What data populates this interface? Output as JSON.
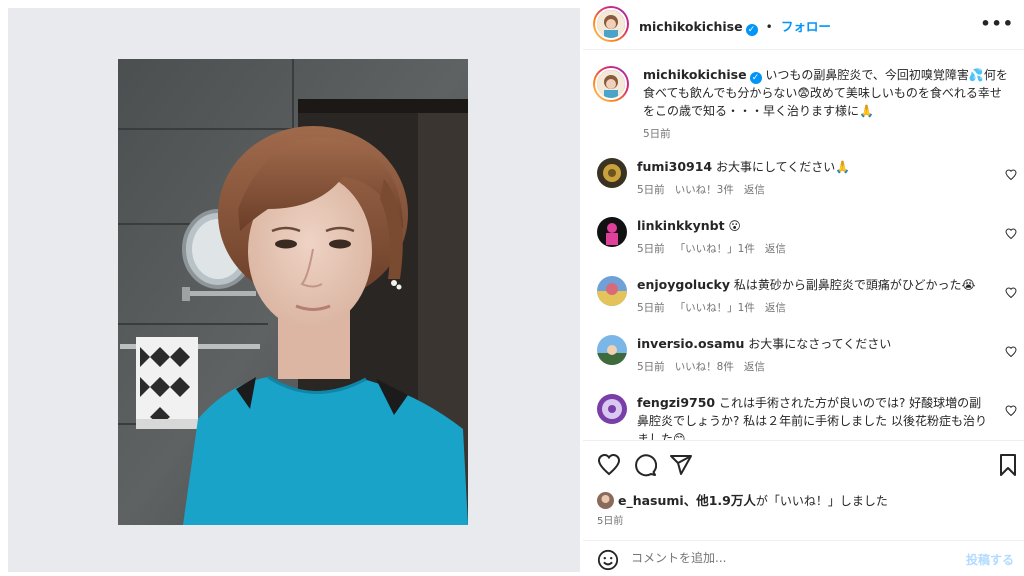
{
  "post": {
    "username": "michikokichise",
    "verified_mark": "✓",
    "separator": "•",
    "follow_label": "フォロー",
    "more_label": "•••",
    "caption": "いつもの副鼻腔炎で、今回初嗅覚障害💦何を食べても飲んでも分からない😨改めて美味しいものを食べれる幸せをこの歳で知る・・・早く治ります様に🙏",
    "caption_time": "5日前"
  },
  "comments": [
    {
      "username": "fumi30914",
      "text": "お大事にしてください🙏",
      "time": "5日前",
      "likes": "いいね！3件",
      "reply": "返信"
    },
    {
      "username": "linkinkkynbt",
      "text": "😮",
      "time": "5日前",
      "likes": "「いいね！」1件",
      "reply": "返信"
    },
    {
      "username": "enjoygolucky",
      "text": "私は黄砂から副鼻腔炎で頭痛がひどかった😭",
      "time": "5日前",
      "likes": "「いいね！」1件",
      "reply": "返信"
    },
    {
      "username": "inversio.osamu",
      "text": "お大事になさってください",
      "time": "5日前",
      "likes": "いいね！8件",
      "reply": "返信"
    },
    {
      "username": "fengzi9750",
      "text": "これは手術された方が良いのでは? 好酸球増の副鼻腔炎でしょうか? 私は２年前に手術しました 以後花粉症も治りました😊",
      "time": "",
      "likes": "",
      "reply": ""
    }
  ],
  "footer": {
    "likes_user": "e_hasumi",
    "likes_rest": "、他1.9万人",
    "likes_suffix": "が「いいね！」しました",
    "date": "5日前",
    "comment_placeholder": "コメントを追加...",
    "post_label": "投稿する"
  },
  "icons": {
    "like": "heart-icon",
    "comment": "comment-icon",
    "share": "paper-plane-icon",
    "save": "bookmark-icon",
    "emoji": "smiley-icon"
  },
  "colors": {
    "accent": "#0095f6",
    "post_disabled": "#b3dbff",
    "shirt": "#1aa3c8"
  }
}
